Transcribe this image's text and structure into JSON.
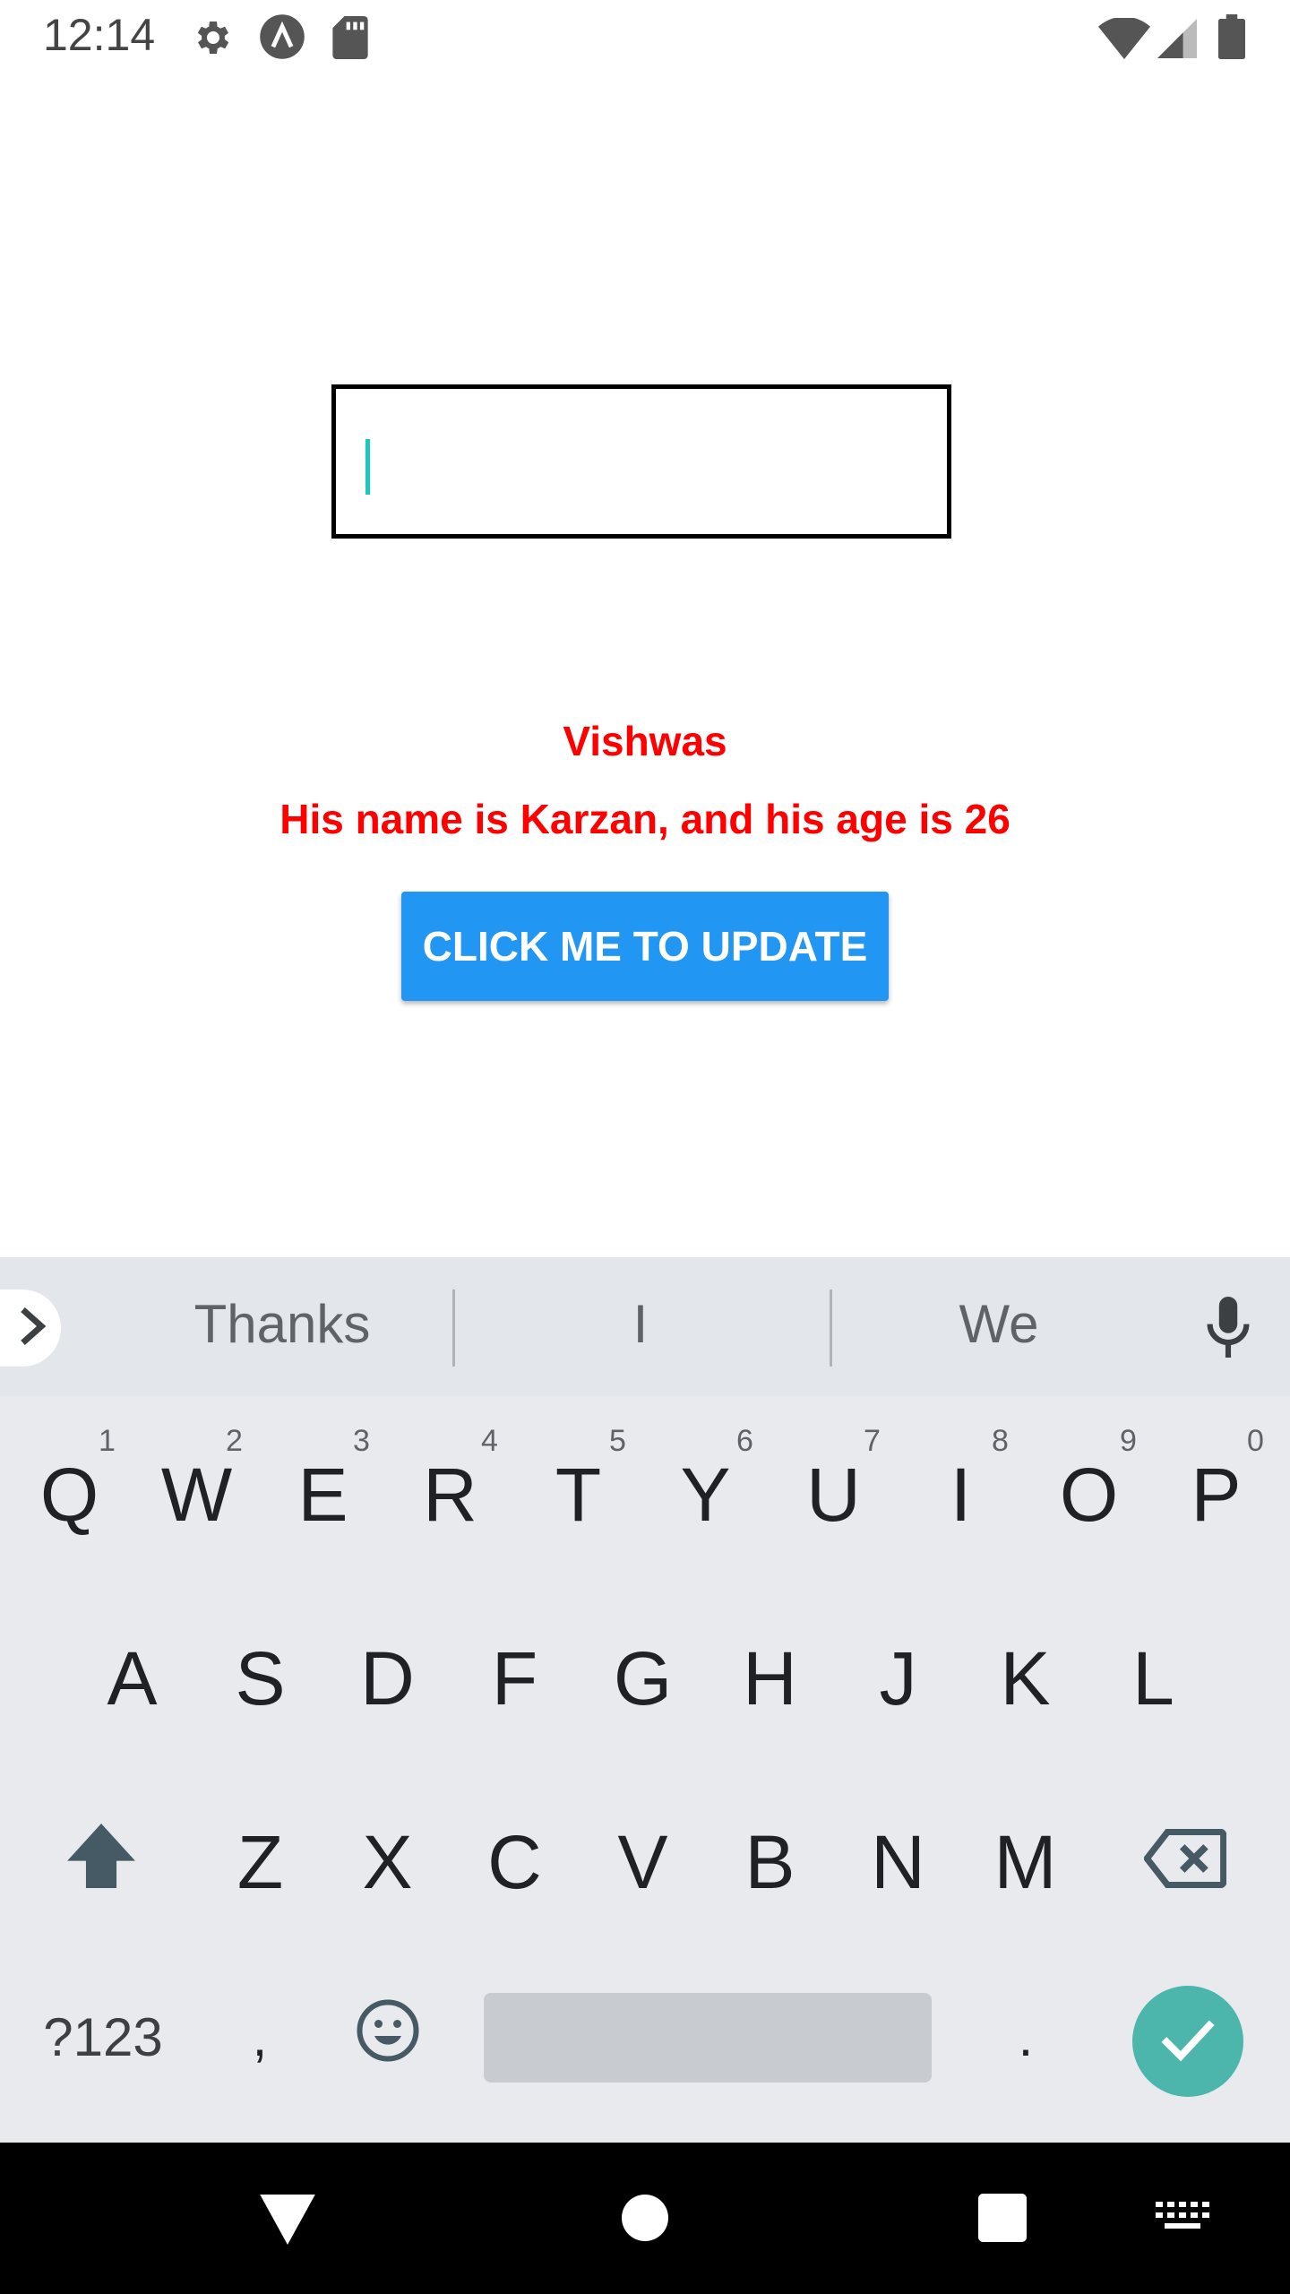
{
  "status_bar": {
    "time": "12:14",
    "icons": [
      "settings-icon",
      "app-notification-icon",
      "sd-card-icon",
      "wifi-icon",
      "cellular-signal-icon",
      "battery-icon"
    ]
  },
  "app": {
    "input": {
      "value": "",
      "placeholder": ""
    },
    "name_label": "Vishwas",
    "sentence_label": "His name is Karzan, and his age is 26",
    "update_button_label": "CLICK ME TO UPDATE",
    "accent_colors": {
      "label": "#ff0000",
      "button": "#2196f3",
      "caret": "#1ec6c0"
    }
  },
  "keyboard": {
    "suggestions": [
      "Thanks",
      "I",
      "We"
    ],
    "row1": [
      "Q",
      "W",
      "E",
      "R",
      "T",
      "Y",
      "U",
      "I",
      "O",
      "P"
    ],
    "row1_hints": [
      "1",
      "2",
      "3",
      "4",
      "5",
      "6",
      "7",
      "8",
      "9",
      "0"
    ],
    "row2": [
      "A",
      "S",
      "D",
      "F",
      "G",
      "H",
      "J",
      "K",
      "L"
    ],
    "row3": [
      "Z",
      "X",
      "C",
      "V",
      "B",
      "N",
      "M"
    ],
    "symbols_key": "?123",
    "comma_key": ",",
    "period_key": ".",
    "enter_color": "#4db6ac"
  },
  "nav_bar": {
    "icons": [
      "back-icon",
      "home-icon",
      "recents-icon",
      "keyboard-switch-icon"
    ]
  }
}
